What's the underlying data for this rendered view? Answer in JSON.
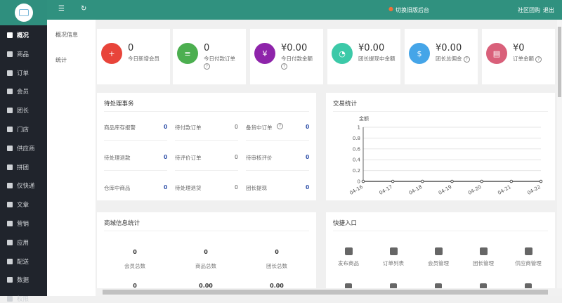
{
  "sidebar": {
    "items": [
      {
        "label": "概况",
        "icon": "home-icon"
      },
      {
        "label": "商品",
        "icon": "goods-icon"
      },
      {
        "label": "订单",
        "icon": "order-icon"
      },
      {
        "label": "会员",
        "icon": "member-icon"
      },
      {
        "label": "团长",
        "icon": "leader-icon"
      },
      {
        "label": "门店",
        "icon": "store-icon"
      },
      {
        "label": "供应商",
        "icon": "supplier-icon"
      },
      {
        "label": "拼团",
        "icon": "group-icon"
      },
      {
        "label": "仅快递",
        "icon": "express-icon"
      },
      {
        "label": "文章",
        "icon": "article-icon"
      },
      {
        "label": "营销",
        "icon": "marketing-icon"
      },
      {
        "label": "应用",
        "icon": "app-icon"
      },
      {
        "label": "配送",
        "icon": "delivery-icon"
      },
      {
        "label": "数据",
        "icon": "data-icon"
      },
      {
        "label": "权限",
        "icon": "permission-icon"
      }
    ]
  },
  "topbar": {
    "switch_old": "切换旧版后台",
    "community": "社区团购",
    "logout": "退出"
  },
  "subnav": {
    "items": [
      "概况信息",
      "统计"
    ]
  },
  "cards": [
    {
      "value": "0",
      "label": "今日新增会员",
      "color": "#e8443a",
      "help": false
    },
    {
      "value": "0",
      "label": "今日付款订单",
      "color": "#4caf50",
      "help": true
    },
    {
      "value": "¥0.00",
      "label": "今日付款金额",
      "color": "#8e24aa",
      "help": true
    },
    {
      "value": "¥0.00",
      "label": "团长提现中金额",
      "color": "#3cc9a8",
      "help": false
    },
    {
      "value": "¥0.00",
      "label": "团长总佣金",
      "color": "#45a5e8",
      "help": true
    },
    {
      "value": "¥0",
      "label": "订单金额",
      "color": "#d9607a",
      "help": true
    }
  ],
  "pending": {
    "title": "待处理事务",
    "rows": [
      [
        {
          "label": "商品库存报警",
          "value": "0"
        },
        {
          "label": "待付款订单",
          "value": "0"
        },
        {
          "label": "备货中订单",
          "value": "0"
        }
      ],
      [
        {
          "label": "待处理退款",
          "value": "0"
        },
        {
          "label": "待评价订单",
          "value": "0"
        },
        {
          "label": "待审核评价",
          "value": "0"
        }
      ],
      [
        {
          "label": "仓库中商品",
          "value": "0"
        },
        {
          "label": "待处理退货",
          "value": "0"
        },
        {
          "label": "团长提现",
          "value": "0"
        }
      ]
    ]
  },
  "chart_data": {
    "type": "line",
    "title": "交易统计",
    "ylabel": "金额",
    "xlabel": "",
    "categories": [
      "04-16",
      "04-17",
      "04-18",
      "04-19",
      "04-20",
      "04-21",
      "04-22"
    ],
    "series": [
      {
        "name": "金额",
        "values": [
          0,
          0,
          0,
          0,
          0,
          0,
          0
        ]
      }
    ],
    "ylim": [
      0,
      1
    ],
    "yticks": [
      "0",
      "0.2",
      "0.4",
      "0.6",
      "0.8",
      "1"
    ],
    "grid": true
  },
  "shop": {
    "title": "商城信息统计",
    "stats": [
      {
        "value": "0",
        "label": "会员总数"
      },
      {
        "value": "0",
        "label": "商品总数"
      },
      {
        "value": "0",
        "label": "团长总数"
      },
      {
        "value": "0"
      },
      {
        "value": "0.00"
      },
      {
        "value": "0.00"
      }
    ]
  },
  "quick": {
    "title": "快捷入口",
    "items": [
      "发布商品",
      "订单列表",
      "会员管理",
      "团长管理",
      "供应商管理"
    ]
  }
}
